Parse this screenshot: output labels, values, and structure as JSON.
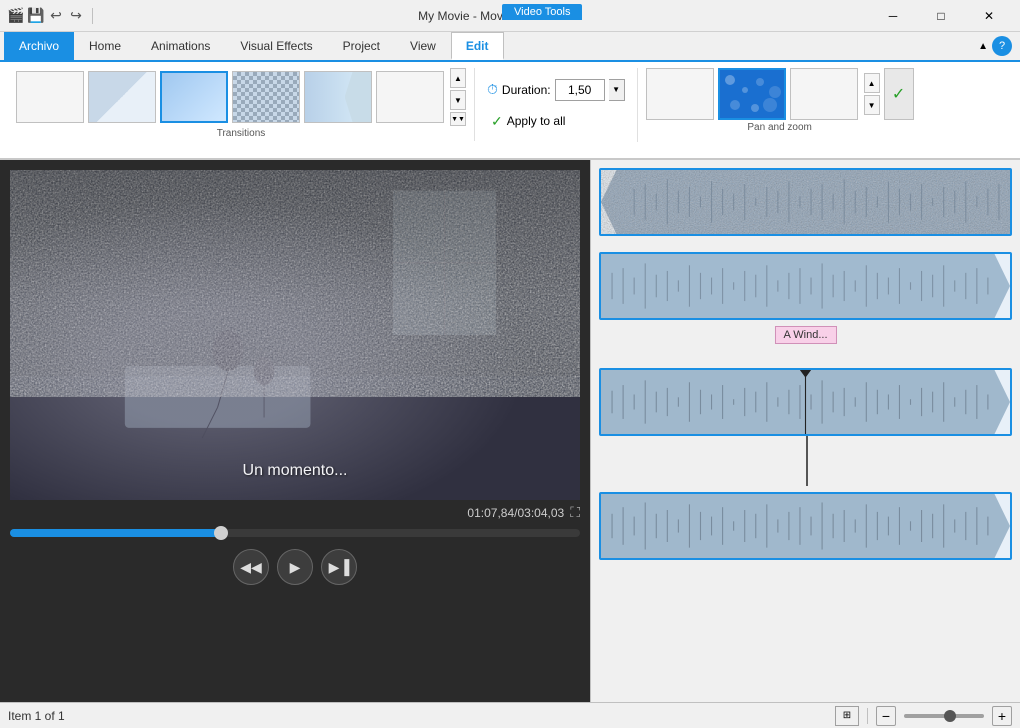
{
  "titleBar": {
    "icons": [
      "logo",
      "save",
      "undo",
      "redo"
    ],
    "title": "My Movie - Movie Maker",
    "videoTools": "Video Tools",
    "controls": [
      "minimize",
      "maximize",
      "close"
    ]
  },
  "menuBar": {
    "tabs": [
      {
        "id": "archivo",
        "label": "Archivo",
        "active": true,
        "style": "blue"
      },
      {
        "id": "home",
        "label": "Home"
      },
      {
        "id": "animations",
        "label": "Animations"
      },
      {
        "id": "visualEffects",
        "label": "Visual Effects"
      },
      {
        "id": "project",
        "label": "Project"
      },
      {
        "id": "view",
        "label": "View"
      },
      {
        "id": "edit",
        "label": "Edit",
        "active": true,
        "style": "underline"
      }
    ]
  },
  "ribbon": {
    "transitions": {
      "label": "Transitions",
      "items": [
        {
          "id": "blank1",
          "type": "blank"
        },
        {
          "id": "diagonal",
          "type": "diagonal"
        },
        {
          "id": "selected",
          "type": "selected",
          "active": true
        },
        {
          "id": "checker",
          "type": "checker"
        },
        {
          "id": "arrow",
          "type": "arrow"
        },
        {
          "id": "blank2",
          "type": "blank"
        }
      ]
    },
    "duration": {
      "label": "Duration:",
      "value": "1,50",
      "unit": ""
    },
    "applyAll": {
      "label": "Apply to all"
    },
    "panZoom": {
      "label": "Pan and zoom",
      "items": [
        {
          "id": "pz1",
          "type": "blank"
        },
        {
          "id": "pz2",
          "type": "selected",
          "active": true
        },
        {
          "id": "pz3",
          "type": "blank2"
        }
      ],
      "moreBtn": "▾",
      "addBtn": "✓"
    }
  },
  "preview": {
    "subtitle": "Un momento...",
    "timeDisplay": "01:07,84/03:04,03",
    "progress": 37,
    "controls": {
      "rewind": "◀◀",
      "play": "▶",
      "forward": "▶▐"
    }
  },
  "timeline": {
    "clips": [
      {
        "id": "clip1",
        "type": "first",
        "hasLabel": false,
        "playhead": true
      },
      {
        "id": "clip2",
        "type": "normal",
        "hasLabel": true,
        "label": "A Wind...",
        "playhead": false
      },
      {
        "id": "clip3",
        "type": "normal",
        "hasLabel": false,
        "playhead": true,
        "playheadPos": 50
      },
      {
        "id": "clip4",
        "type": "normal",
        "hasLabel": false,
        "playhead": false
      }
    ]
  },
  "statusBar": {
    "itemCount": "Item 1 of 1",
    "zoomMinus": "−",
    "zoomPlus": "+",
    "storyboardIcon": "⊞"
  }
}
